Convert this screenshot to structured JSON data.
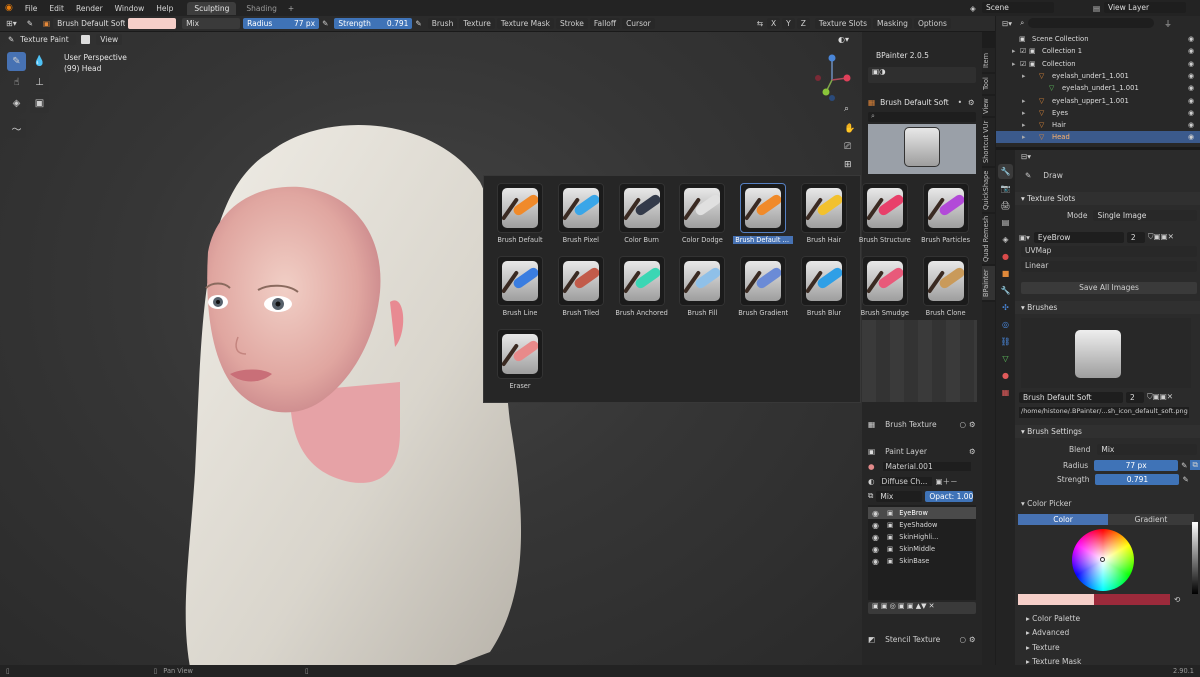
{
  "topbar": {
    "menus": [
      "File",
      "Edit",
      "Render",
      "Window",
      "Help"
    ],
    "workspace_tabs": [
      "Sculpting",
      "Shading"
    ],
    "add_tab": "+",
    "scene": "Scene",
    "view_layer": "View Layer"
  },
  "header": {
    "brush_name": "Brush Default Soft",
    "blend": "Mix",
    "radius_label": "Radius",
    "radius_value": "77 px",
    "strength_label": "Strength",
    "strength_value": "0.791",
    "menus": [
      "Brush",
      "Texture",
      "Texture Mask",
      "Stroke",
      "Falloff",
      "Cursor"
    ],
    "axes": [
      "X",
      "Y",
      "Z"
    ],
    "right_menus": [
      "Texture Slots",
      "Masking",
      "Options"
    ]
  },
  "viewport": {
    "mode": "Texture Paint",
    "view_menu": "View",
    "perspective": "User Perspective",
    "object": "(99) Head"
  },
  "brush_popup": {
    "brushes": [
      {
        "name": "Brush Default",
        "icon": "orange-stroke-brush-icon",
        "color": "#f08a2a"
      },
      {
        "name": "Brush Pixel",
        "icon": "pencil-icon",
        "color": "#3aa6e8"
      },
      {
        "name": "Color Burn",
        "icon": "dark-blob-icon",
        "color": "#333a4a"
      },
      {
        "name": "Color Dodge",
        "icon": "light-blob-icon",
        "color": "#e0e0e0"
      },
      {
        "name": "Brush Default S...",
        "icon": "orange-stroke-brush-icon",
        "color": "#f08a2a"
      },
      {
        "name": "Brush Hair",
        "icon": "yellow-stroke-brush-icon",
        "color": "#f2c12e"
      },
      {
        "name": "Brush Structure",
        "icon": "pink-stroke-brush-icon",
        "color": "#e8406a"
      },
      {
        "name": "Brush Particles",
        "icon": "purple-stroke-brush-icon",
        "color": "#b24ad8"
      },
      {
        "name": "Brush Line",
        "icon": "blue-line-brush-icon",
        "color": "#3a7de0"
      },
      {
        "name": "Brush Tiled",
        "icon": "tiled-brush-icon",
        "color": "#c25b4a"
      },
      {
        "name": "Brush Anchored",
        "icon": "anchored-brush-icon",
        "color": "#3bd6b4"
      },
      {
        "name": "Brush Fill",
        "icon": "paint-bucket-icon",
        "color": "#8fc0e8"
      },
      {
        "name": "Brush Gradient",
        "icon": "gradient-bucket-icon",
        "color": "#6b8bd6"
      },
      {
        "name": "Brush Blur",
        "icon": "finger-blur-icon",
        "color": "#2f9fe6"
      },
      {
        "name": "Brush Smudge",
        "icon": "finger-smudge-icon",
        "color": "#e85a7a"
      },
      {
        "name": "Brush Clone",
        "icon": "stamp-icon",
        "color": "#c99a5a"
      },
      {
        "name": "Eraser",
        "icon": "eraser-icon",
        "color": "#e88a8a"
      }
    ],
    "selected_index": 4
  },
  "bpainter": {
    "title": "BPainter 2.0.5",
    "brush_name": "Brush Default Soft",
    "brush_texture": "Brush Texture",
    "paint_layer": "Paint Layer",
    "material": "Material.001",
    "channel": "Diffuse Ch...",
    "blend": "Mix",
    "opacity": "Opact: 1.00",
    "layers": [
      "EyeBrow",
      "EyeShadow",
      "SkinHighli...",
      "SkinMiddle",
      "SkinBase"
    ],
    "selected_layer": 0,
    "stencil": "Stencil Texture",
    "side_tabs": [
      "Item",
      "Tool",
      "View",
      "Shortcut VUr",
      "QuickShape",
      "Quad Remesh",
      "BPainter"
    ]
  },
  "outliner": {
    "rows": [
      {
        "label": "Scene Collection",
        "indent": 0,
        "icon": "collection-icon"
      },
      {
        "label": "Collection 1",
        "indent": 1,
        "icon": "collection-icon"
      },
      {
        "label": "Collection",
        "indent": 1,
        "icon": "collection-icon"
      },
      {
        "label": "eyelash_under1_1.001",
        "indent": 2,
        "icon": "object-icon"
      },
      {
        "label": "eyelash_under1_1.001",
        "indent": 3,
        "icon": "mesh-icon"
      },
      {
        "label": "eyelash_upper1_1.001",
        "indent": 2,
        "icon": "object-icon"
      },
      {
        "label": "Eyes",
        "indent": 2,
        "icon": "object-icon"
      },
      {
        "label": "Hair",
        "indent": 2,
        "icon": "object-icon"
      },
      {
        "label": "Head",
        "indent": 2,
        "icon": "object-icon"
      }
    ],
    "selected": "Head"
  },
  "properties": {
    "tool": "Draw",
    "texture_slots": "Texture Slots",
    "mode_label": "Mode",
    "mode_value": "Single Image",
    "image": "EyeBrow",
    "image_users": "2",
    "uvmap": "UVMap",
    "interp": "Linear",
    "save_all": "Save All Images",
    "brushes": "Brushes",
    "brush_name": "Brush Default Soft",
    "brush_users": "2",
    "brush_path": "/home/histone/.BPainter/...sh_icon_default_soft.png",
    "brush_settings": "Brush Settings",
    "blend_label": "Blend",
    "blend_value": "Mix",
    "radius_label": "Radius",
    "radius_value": "77 px",
    "strength_label": "Strength",
    "strength_value": "0.791",
    "color_picker": "Color Picker",
    "color_tab": "Color",
    "gradient_tab": "Gradient",
    "primary_color": "#f6cfc9",
    "secondary_color": "#9c2a3b",
    "sections": [
      "Color Palette",
      "Advanced",
      "Texture",
      "Texture Mask"
    ]
  },
  "status": {
    "left": "Pan View",
    "version": "2.90.1"
  }
}
